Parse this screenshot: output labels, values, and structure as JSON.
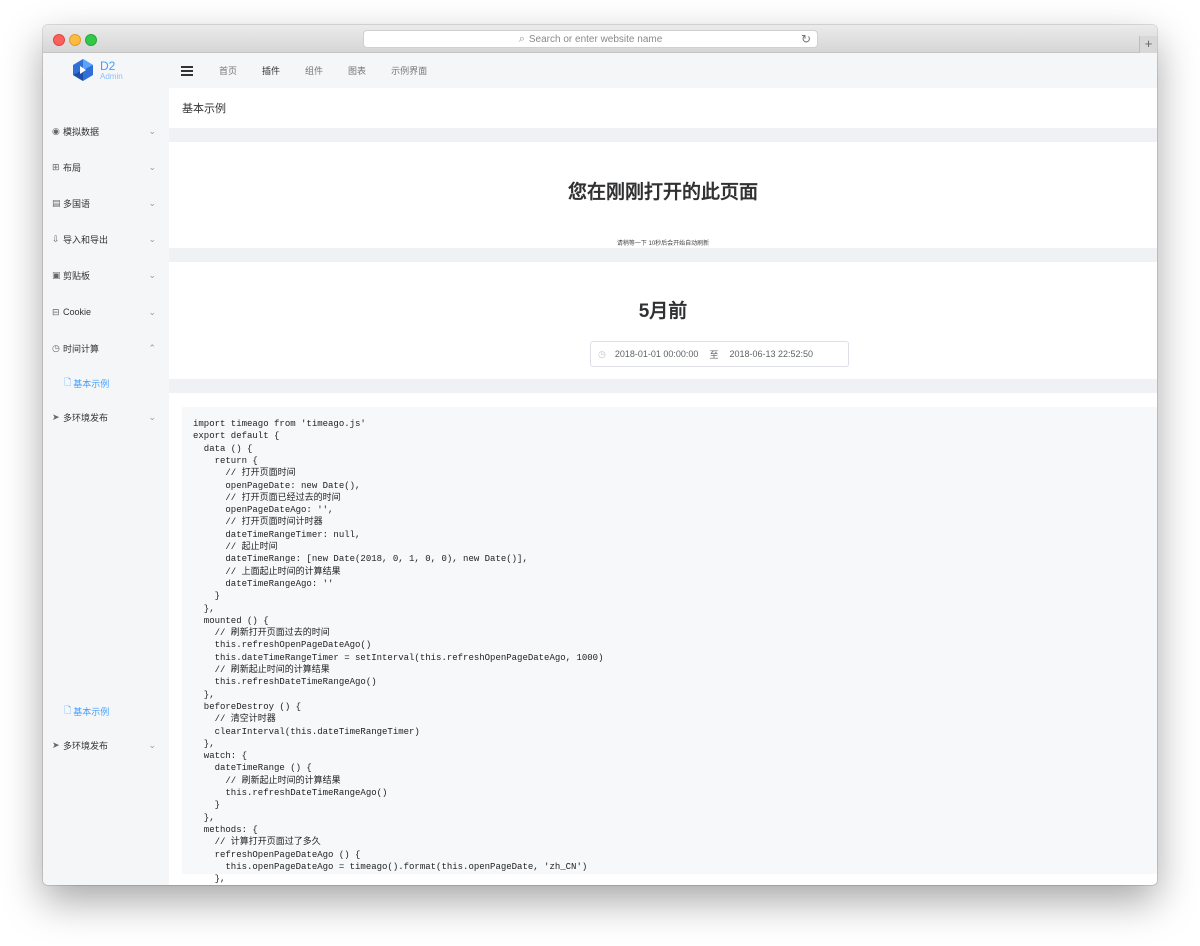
{
  "browser": {
    "url_placeholder": "Search or enter website name",
    "search_icon": "search-icon",
    "reload_icon": "reload-icon",
    "newtab_label": "+"
  },
  "logo": {
    "title": "D2",
    "subtitle": "Admin"
  },
  "sidebar": {
    "items": [
      {
        "label": "模拟数据",
        "icon": "globe-icon",
        "chevron": "chevron-down"
      },
      {
        "label": "布局",
        "icon": "layout-icon",
        "chevron": "chevron-down"
      },
      {
        "label": "多国语",
        "icon": "book-icon",
        "chevron": "chevron-down"
      },
      {
        "label": "导入和导出",
        "icon": "download-icon",
        "chevron": "chevron-down"
      },
      {
        "label": "剪贴板",
        "icon": "clipboard-icon",
        "chevron": "chevron-down"
      },
      {
        "label": "Cookie",
        "icon": "database-icon",
        "chevron": "chevron-down"
      },
      {
        "label": "时间计算",
        "icon": "clock-icon",
        "chevron": "chevron-up"
      },
      {
        "label": "基本示例",
        "icon": "file-icon",
        "active": true
      },
      {
        "label": "多环境发布",
        "icon": "send-icon",
        "chevron": "chevron-down"
      },
      {
        "label": "基本示例",
        "icon": "file-icon",
        "active": true
      },
      {
        "label": "多环境发布",
        "icon": "send-icon",
        "chevron": "chevron-down"
      }
    ]
  },
  "topnav": {
    "tabs": [
      "首页",
      "插件",
      "组件",
      "图表",
      "示例界面"
    ],
    "active": "插件"
  },
  "page": {
    "title": "基本示例",
    "card1_title": "您在刚刚打开的此页面",
    "card1_note": "请稍等一下 10秒后会开始自动刷新",
    "card2_title": "5月前",
    "range_start": "2018-01-01 00:00:00",
    "range_sep": "至",
    "range_end": "2018-06-13 22:52:50"
  },
  "code": [
    "import timeago from 'timeago.js'",
    "export default {",
    "  data () {",
    "    return {",
    "      // 打开页面时间",
    "      openPageDate: new Date(),",
    "      // 打开页面已经过去的时间",
    "      openPageDateAgo: '',",
    "      // 打开页面时间计时器",
    "      dateTimeRangeTimer: null,",
    "      // 起止时间",
    "      dateTimeRange: [new Date(2018, 0, 1, 0, 0), new Date()],",
    "      // 上面起止时间的计算结果",
    "      dateTimeRangeAgo: ''",
    "    }",
    "  },",
    "  mounted () {",
    "    // 刷新打开页面过去的时间",
    "    this.refreshOpenPageDateAgo()",
    "    this.dateTimeRangeTimer = setInterval(this.refreshOpenPageDateAgo, 1000)",
    "    // 刷新起止时间的计算结果",
    "    this.refreshDateTimeRangeAgo()",
    "  },",
    "  beforeDestroy () {",
    "    // 清空计时器",
    "    clearInterval(this.dateTimeRangeTimer)",
    "  },",
    "  watch: {",
    "    dateTimeRange () {",
    "      // 刷新起止时间的计算结果",
    "      this.refreshDateTimeRangeAgo()",
    "    }",
    "  },",
    "  methods: {",
    "    // 计算打开页面过了多久",
    "    refreshOpenPageDateAgo () {",
    "      this.openPageDateAgo = timeago().format(this.openPageDate, 'zh_CN')",
    "    },"
  ],
  "colors": {
    "accent": "#409eff",
    "sidebar_bg": "#f5f6f8",
    "content_bg": "#f0f1f4",
    "code_bg": "#f6f8fa"
  }
}
